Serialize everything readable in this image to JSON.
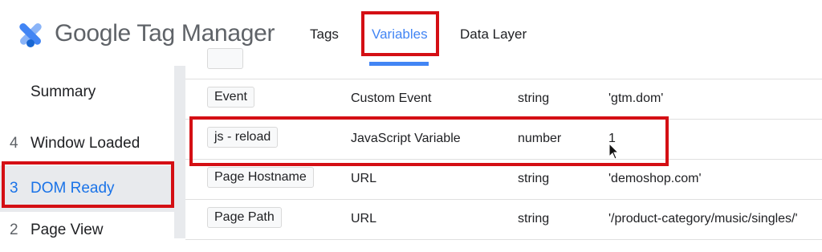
{
  "header": {
    "app_title": "Google Tag Manager",
    "tabs": [
      {
        "label": "Tags"
      },
      {
        "label": "Variables",
        "active": true
      },
      {
        "label": "Data Layer"
      }
    ],
    "accent_color": "#4285f4",
    "highlight_color": "#d40f14"
  },
  "sidebar": {
    "items": [
      {
        "num": "",
        "label": "Summary"
      },
      {
        "num": "4",
        "label": "Window Loaded"
      },
      {
        "num": "3",
        "label": "DOM Ready",
        "selected": true
      },
      {
        "num": "2",
        "label": "Page View"
      }
    ]
  },
  "variables": {
    "rows": [
      {
        "name": "Event",
        "type": "Custom Event",
        "return_type": "string",
        "value": "'gtm.dom'"
      },
      {
        "name": "js - reload",
        "type": "JavaScript Variable",
        "return_type": "number",
        "value": "1"
      },
      {
        "name": "Page Hostname",
        "type": "URL",
        "return_type": "string",
        "value": "'demoshop.com'"
      },
      {
        "name": "Page Path",
        "type": "URL",
        "return_type": "string",
        "value": "'/product-category/music/singles/'"
      }
    ]
  }
}
